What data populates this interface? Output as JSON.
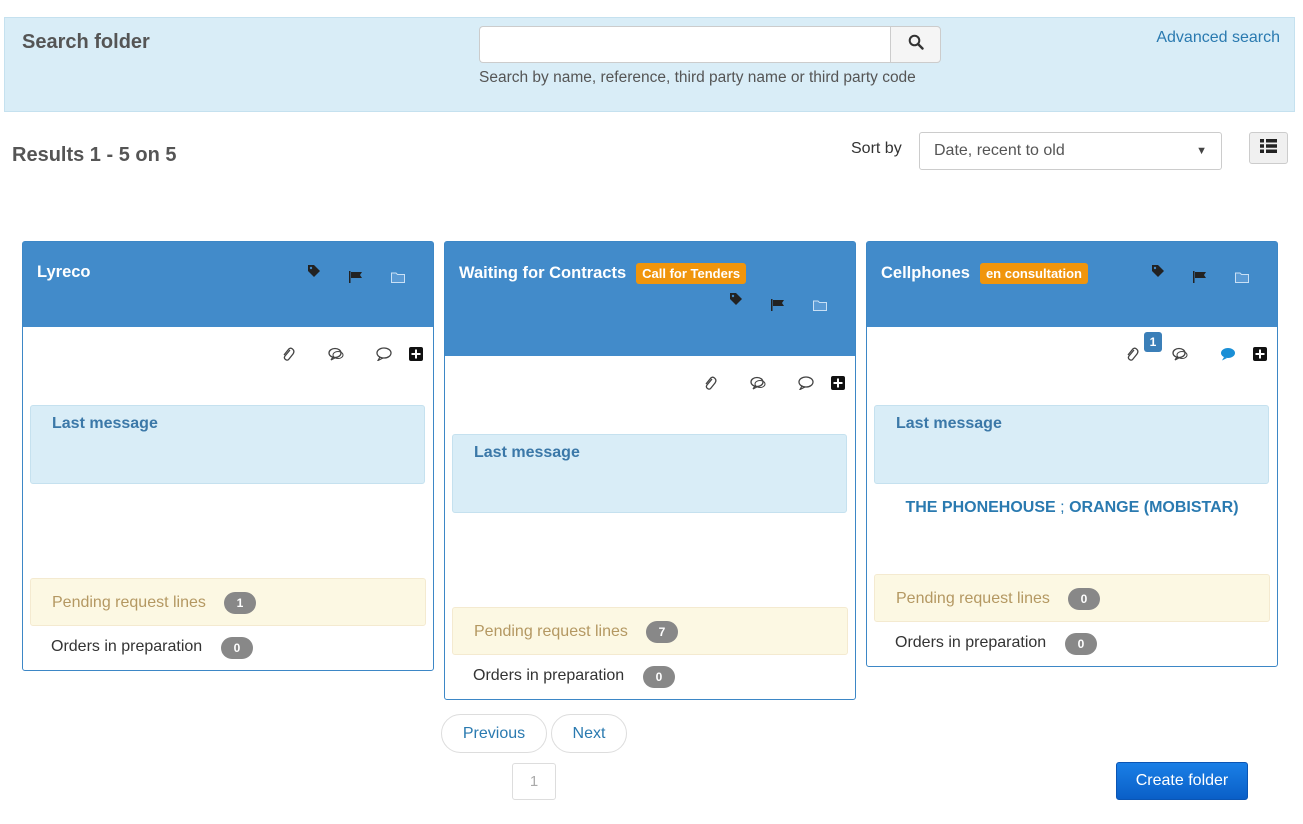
{
  "search": {
    "title": "Search folder",
    "query": "",
    "hint": "Search by name, reference, third party name or third party code",
    "advanced_label": "Advanced search"
  },
  "results": {
    "count_label": "Results 1 - 5 on 5",
    "sort_label": "Sort by",
    "sort_value": "Date, recent to old"
  },
  "cards": [
    {
      "title": "Lyreco",
      "status": "",
      "last_message_label": "Last message",
      "third_parties": [],
      "pending_label": "Pending request lines",
      "pending_count": "1",
      "orders_label": "Orders in preparation",
      "orders_count": "0"
    },
    {
      "title": "Waiting for Contracts",
      "status": "Call for Tenders",
      "last_message_label": "Last message",
      "third_parties": [],
      "pending_label": "Pending request lines",
      "pending_count": "7",
      "orders_label": "Orders in preparation",
      "orders_count": "0"
    },
    {
      "title": "Cellphones",
      "status": "en consultation",
      "comment_count": "1",
      "last_message_label": "Last message",
      "third_parties": [
        "THE PHONEHOUSE",
        "ORANGE (MOBISTAR)"
      ],
      "third_party_separator": ";",
      "pending_label": "Pending request lines",
      "pending_count": "0",
      "orders_label": "Orders in preparation",
      "orders_count": "0"
    }
  ],
  "pagination": {
    "previous_label": "Previous",
    "next_label": "Next",
    "current_page": "1"
  },
  "actions": {
    "create_label": "Create folder"
  },
  "colors": {
    "header_blue": "#428bca",
    "status_orange": "#f0950c",
    "panel_blue": "#d9edf7",
    "pending_yellow": "#fcf8e3",
    "link_blue": "#2a7ab0",
    "comment_active": "#1a8fd6"
  },
  "icons": [
    "search-icon",
    "list-view-icon",
    "tag-icon",
    "flag-icon",
    "folder-icon",
    "paperclip-icon",
    "chat-icon",
    "comment-icon",
    "plus-icon"
  ]
}
